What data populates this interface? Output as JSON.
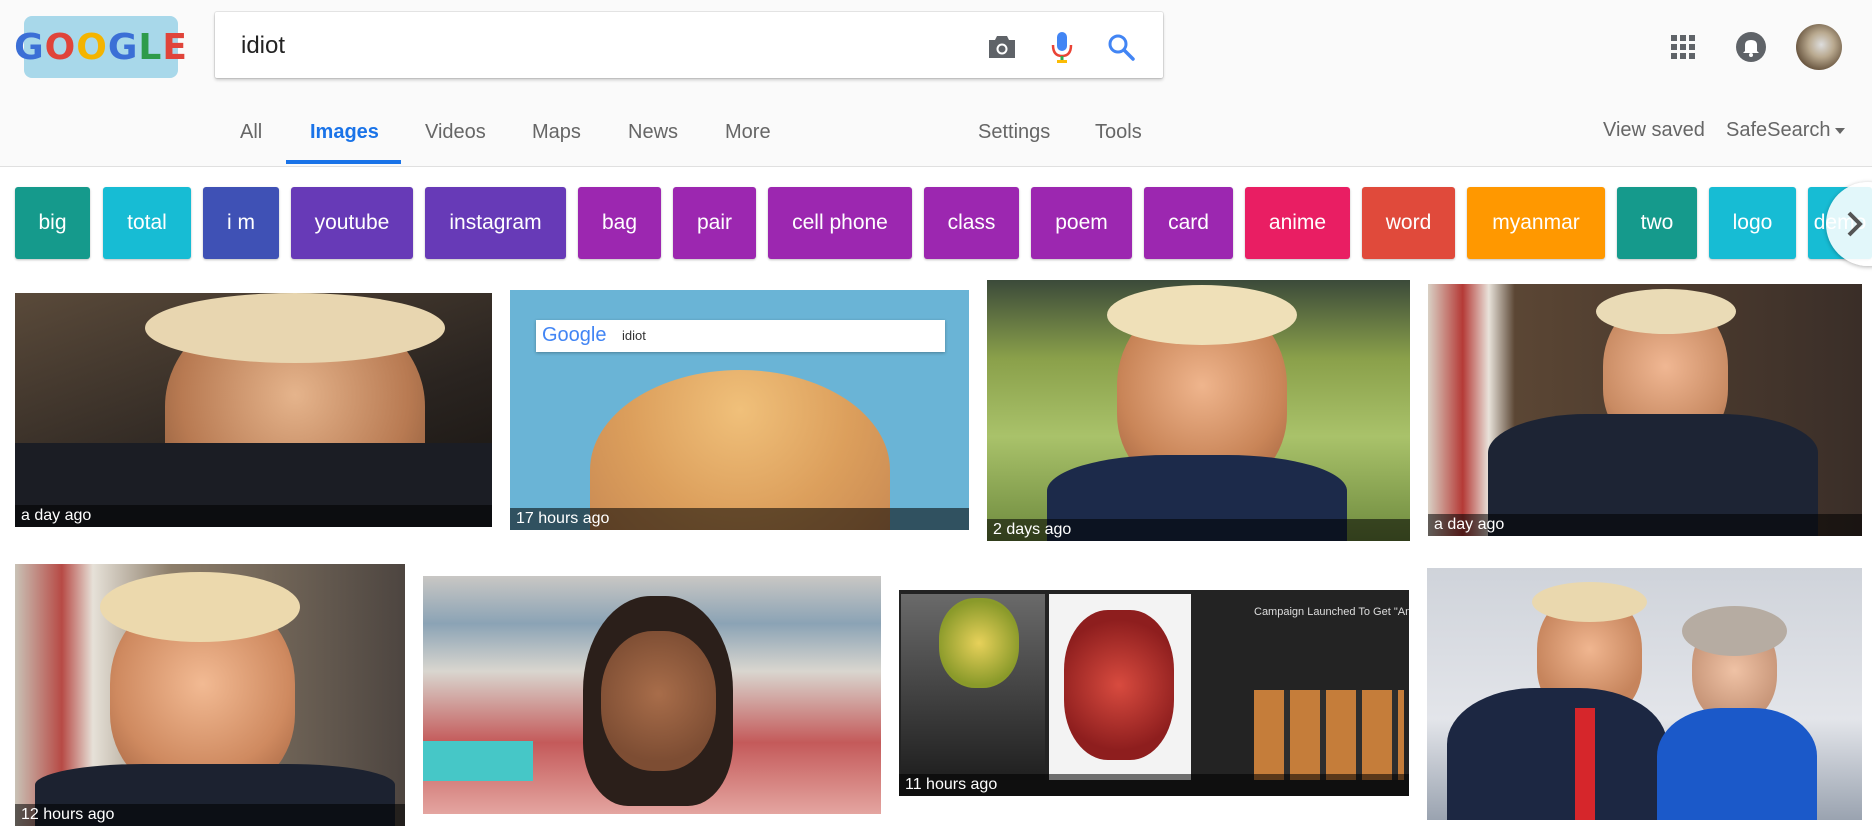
{
  "logo": {
    "letters": [
      "G",
      "O",
      "O",
      "G",
      "L",
      "E"
    ]
  },
  "search": {
    "value": "idiot"
  },
  "tabs": [
    {
      "label": "All"
    },
    {
      "label": "Images"
    },
    {
      "label": "Videos"
    },
    {
      "label": "Maps"
    },
    {
      "label": "News"
    },
    {
      "label": "More"
    },
    {
      "label": "Settings"
    },
    {
      "label": "Tools"
    }
  ],
  "right_links": {
    "view_saved": "View saved",
    "safesearch": "SafeSearch"
  },
  "chips": [
    {
      "label": "big",
      "color": "#159a8c"
    },
    {
      "label": "total",
      "color": "#17bcd4"
    },
    {
      "label": "i m",
      "color": "#3f51b5"
    },
    {
      "label": "youtube",
      "color": "#673ab7"
    },
    {
      "label": "instagram",
      "color": "#673ab7"
    },
    {
      "label": "bag",
      "color": "#9c27b0"
    },
    {
      "label": "pair",
      "color": "#9c27b0"
    },
    {
      "label": "cell phone",
      "color": "#9c27b0"
    },
    {
      "label": "class",
      "color": "#9c27b0"
    },
    {
      "label": "poem",
      "color": "#9c27b0"
    },
    {
      "label": "card",
      "color": "#9c27b0"
    },
    {
      "label": "anime",
      "color": "#e91e63"
    },
    {
      "label": "word",
      "color": "#e04a3b"
    },
    {
      "label": "myanmar",
      "color": "#ff9800"
    },
    {
      "label": "two",
      "color": "#159a8c"
    },
    {
      "label": "logo",
      "color": "#17bcd4"
    },
    {
      "label": "demo",
      "color": "#17bcd4"
    }
  ],
  "images": [
    {
      "time": "a day ago"
    },
    {
      "time": "17 hours ago",
      "inner_search": "idiot",
      "inner_logo": "Google"
    },
    {
      "time": "2 days ago"
    },
    {
      "time": "a day ago"
    },
    {
      "time": "12 hours ago"
    },
    {
      "time": ""
    },
    {
      "time": "11 hours ago",
      "caption": "Campaign Launched To Get \"Americ"
    },
    {
      "time": ""
    }
  ]
}
